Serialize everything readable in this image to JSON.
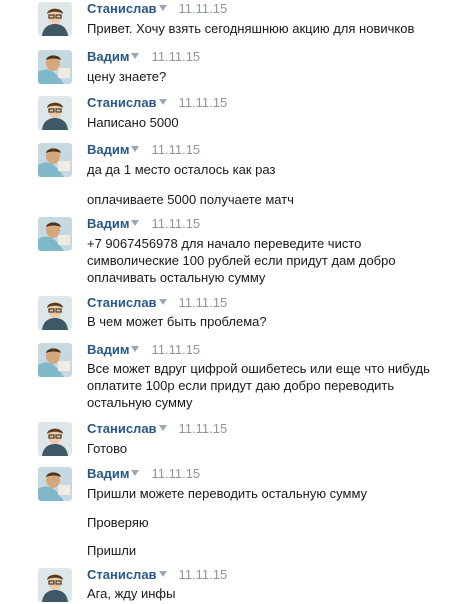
{
  "messages": [
    {
      "author": "Станислав",
      "date": "11.11.15",
      "avatar": "stanislav",
      "lines": [
        "Привет. Хочу взять сегодняшнюю акцию для новичков"
      ]
    },
    {
      "author": "Вадим",
      "date": "11.11.15",
      "avatar": "vadim",
      "lines": [
        "цену знаете?"
      ]
    },
    {
      "author": "Станислав",
      "date": "11.11.15",
      "avatar": "stanislav",
      "lines": [
        "Написано 5000"
      ]
    },
    {
      "author": "Вадим",
      "date": "11.11.15",
      "avatar": "vadim",
      "lines": [
        "да да 1 место осталось как раз",
        "оплачиваете 5000 получаете матч"
      ]
    },
    {
      "author": "Вадим",
      "date": "11.11.15",
      "avatar": "vadim",
      "lines": [
        "+7 9067456978 для начало переведите чисто",
        "символические 100 рублей если придут дам добро",
        "оплачивать остальную сумму"
      ]
    },
    {
      "author": "Станислав",
      "date": "11.11.15",
      "avatar": "stanislav",
      "lines": [
        "В чем может быть проблема?"
      ]
    },
    {
      "author": "Вадим",
      "date": "11.11.15",
      "avatar": "vadim",
      "lines": [
        "Все может вдруг цифрой ошибетесь или еще что нибудь",
        "оплатите 100р если придут даю добро переводить",
        "остальную сумму"
      ]
    },
    {
      "author": "Станислав",
      "date": "11.11.15",
      "avatar": "stanislav",
      "lines": [
        "Готово"
      ]
    },
    {
      "author": "Вадим",
      "date": "11.11.15",
      "avatar": "vadim",
      "lines": [
        "Пришли можете переводить остальную сумму",
        "Проверяю",
        "Пришли"
      ]
    },
    {
      "author": "Станислав",
      "date": "11.11.15",
      "avatar": "stanislav",
      "lines": [
        "Ага, жду инфы"
      ]
    }
  ]
}
